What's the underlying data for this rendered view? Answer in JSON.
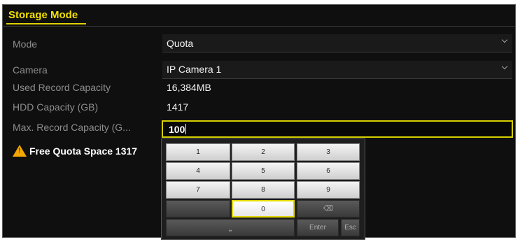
{
  "header": {
    "title": "Storage Mode"
  },
  "form": {
    "mode": {
      "label": "Mode",
      "value": "Quota"
    },
    "camera": {
      "label": "Camera",
      "value": "IP Camera 1"
    },
    "used": {
      "label": "Used Record Capacity",
      "value": "16,384MB"
    },
    "hdd": {
      "label": "HDD Capacity (GB)",
      "value": "1417"
    },
    "max": {
      "label": "Max. Record Capacity (G...",
      "value": "100"
    }
  },
  "warning": {
    "text": "Free Quota Space 1317",
    "icon": "warning-icon"
  },
  "keypad": {
    "keys": [
      "1",
      "2",
      "3",
      "4",
      "5",
      "6",
      "7",
      "8",
      "9",
      "0"
    ],
    "backspace": "⌫",
    "enter_label": "Enter",
    "esc_label": "Esc",
    "space_label": "⎵"
  },
  "colors": {
    "accent": "#e0d000",
    "warning": "#f2a800",
    "panel": "#0f0f0f"
  }
}
